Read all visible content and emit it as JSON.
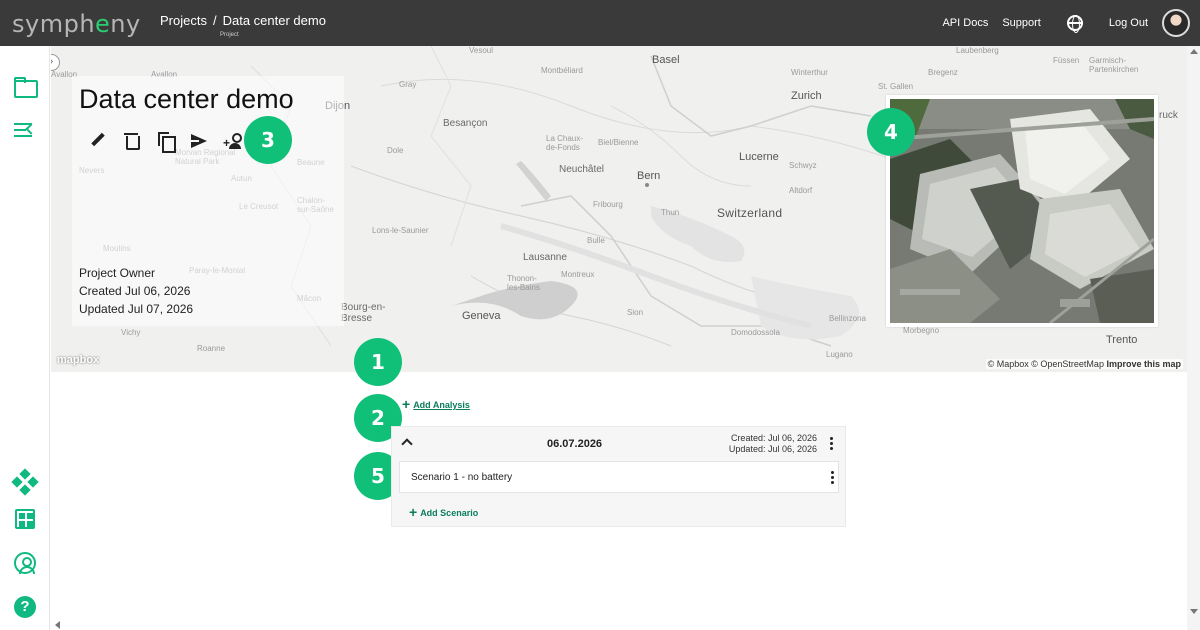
{
  "header": {
    "logo_text_a": "symph",
    "logo_text_b": "e",
    "logo_text_c": "ny",
    "breadcrumb_root": "Projects",
    "breadcrumb_sep": "/",
    "breadcrumb_current": "Data center demo",
    "breadcrumb_sub": "Project",
    "api_docs": "API Docs",
    "support": "Support",
    "logout": "Log Out",
    "language_icon": "globe-icon"
  },
  "sidebar": {
    "items": [
      {
        "icon": "folder-icon"
      },
      {
        "icon": "list-collapse-icon"
      },
      {
        "icon": "network-icon"
      },
      {
        "icon": "dashboard-grid-icon"
      },
      {
        "icon": "account-icon"
      },
      {
        "icon": "help-icon",
        "glyph": "?"
      }
    ],
    "collapse_glyph": "›"
  },
  "project": {
    "title": "Data center demo",
    "owner_label": "Project Owner",
    "created": "Created Jul 06, 2026",
    "updated": "Updated Jul 07, 2026",
    "tools": [
      "edit-icon",
      "delete-icon",
      "copy-icon",
      "send-icon",
      "add-person-icon"
    ],
    "add_person_plus": "+"
  },
  "map": {
    "labels": [
      "Vesoul",
      "Montbéliard",
      "Basel",
      "Winterthur",
      "Laubenberg",
      "Bregenz",
      "Füssen",
      "Garmisch-Partenkirchen",
      "Zurich",
      "St. Gallen",
      "Dijon",
      "Gray",
      "Besançon",
      "La Chaux-de-Fonds",
      "Biel/Bienne",
      "Lucerne",
      "Schwyz",
      "Neuchâtel",
      "Bern",
      "Dole",
      "Fribourg",
      "Thun",
      "Switzerland",
      "Altdorf",
      "Nevers",
      "Morvan Regional Natural Park",
      "Beaune",
      "Autun",
      "Le Creusot",
      "Chalon-sur-Saône",
      "Lons-le-Saunier",
      "Lausanne",
      "Montreux",
      "Thonon-les-Bains",
      "Bulle",
      "Moulins",
      "Paray-le-Monial",
      "Mâcon",
      "Bourg-en-Bresse",
      "Geneva",
      "Sion",
      "Domodossola",
      "Bellinzona",
      "Vichy",
      "Roanne",
      "Lugano",
      "Morbegno",
      "Trento",
      "ruck",
      "Avallon",
      "Avallon"
    ],
    "attribution_a": "© Mapbox © OpenStreetMap",
    "attribution_b": "Improve this map",
    "logo": "mapbox"
  },
  "badges": [
    "1",
    "2",
    "3",
    "4",
    "5"
  ],
  "analysis": {
    "add_label": "Add Analysis",
    "plus_glyph": "+",
    "date": "06.07.2026",
    "created": "Created: Jul 06, 2026",
    "updated": "Updated: Jul 06, 2026",
    "scenario_name": "Scenario 1 - no battery",
    "add_scenario_label": "Add Scenario"
  },
  "colors": {
    "accent": "#10c079",
    "topbar": "#3a3a3a",
    "link": "#0a7d5c"
  }
}
